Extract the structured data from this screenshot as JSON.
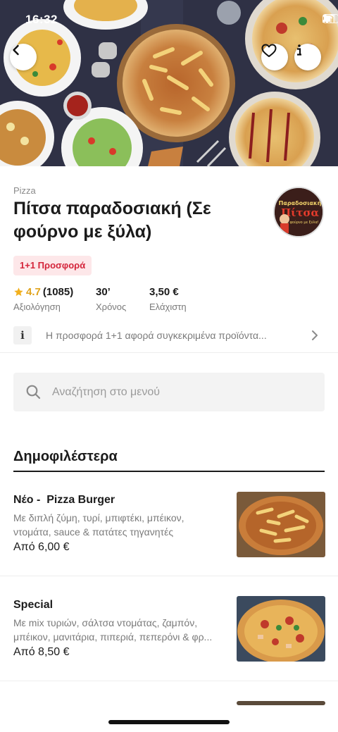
{
  "status_bar": {
    "time": "16:32"
  },
  "icons": {
    "back": "chevron-left-icon",
    "favorite": "heart-icon",
    "info": "info-icon",
    "star": "star-icon",
    "search": "search-icon",
    "chevron": "chevron-right-icon"
  },
  "restaurant": {
    "category": "Pizza",
    "name": "Πίτσα παραδοσιακή (Σε φούρνο με ξύλα)",
    "logo_text_top": "Παραδοσιακή",
    "logo_text_main": "Πίτσα",
    "logo_text_sub": "...σε φούρνο με ξύλα!",
    "offer_badge": "1+1 Προσφορά",
    "rating_value": "4.7",
    "rating_count": "(1085)",
    "rating_label": "Αξιολόγηση",
    "time_value": "30’",
    "time_label": "Χρόνος",
    "min_value": "3,50 €",
    "min_label": "Ελάχιστη",
    "notice": "Η προσφορά 1+1 αφορά συγκεκριμένα προϊόντα..."
  },
  "search": {
    "placeholder": "Αναζήτηση στο μενού"
  },
  "menu": {
    "section_title": "Δημοφιλέστερα",
    "items": [
      {
        "name": "Νέο -  Pizza Burger",
        "description": "Με διπλή ζύμη, τυρί, μπιφτέκι, μπέικον, ντομάτα, sauce & πατάτες τηγανητές",
        "price": "Από 6,00 €"
      },
      {
        "name": "Special",
        "description": "Με mix τυριών, σάλτσα ντομάτας, ζαμπόν, μπέικον, μανιτάρια, πιπεριά, πεπερόνι & φρ...",
        "price": "Από 8,50 €"
      }
    ]
  },
  "colors": {
    "accent_red": "#d4243a",
    "badge_bg": "#fde7e9",
    "star": "#f2b01e"
  }
}
